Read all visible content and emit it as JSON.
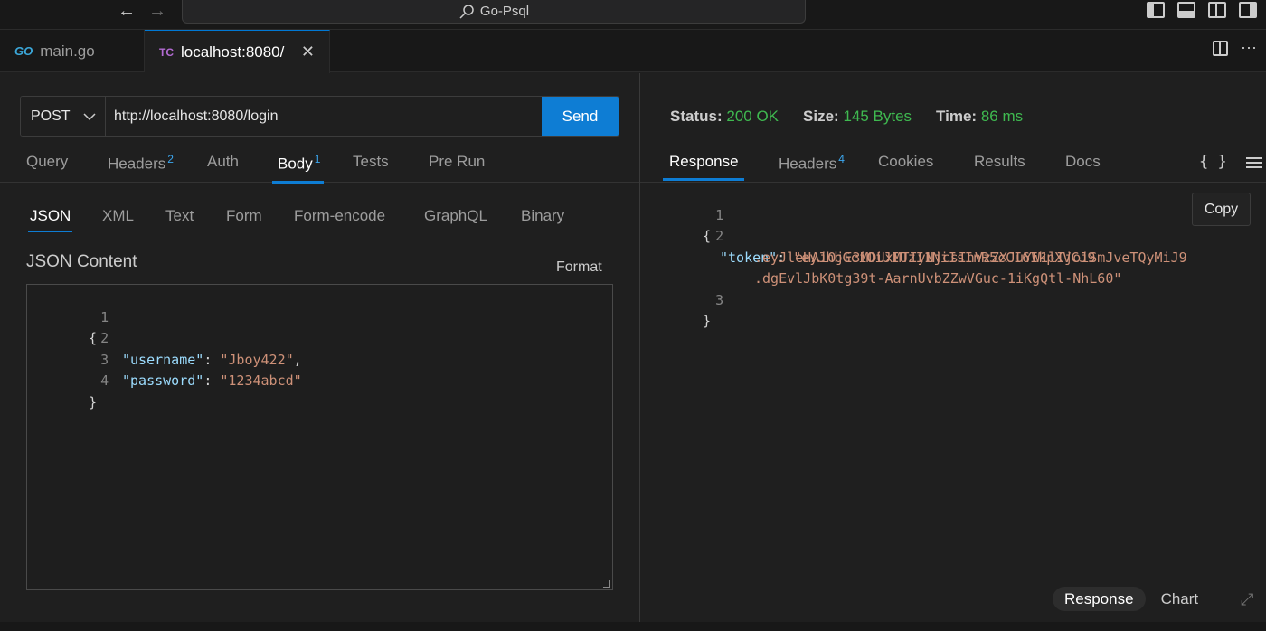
{
  "window": {
    "title": "Go-Psql",
    "back_icon": "←",
    "forward_icon": "→"
  },
  "tabs": [
    {
      "icon": "GO",
      "label": "main.go"
    },
    {
      "icon": "TC",
      "label": "localhost:8080/",
      "close": "✕"
    }
  ],
  "tab_actions": {
    "more": "···"
  },
  "request": {
    "method": "POST",
    "method_caret": "⌵",
    "url": "http://localhost:8080/login",
    "send_label": "Send",
    "tabs": [
      {
        "label": "Query"
      },
      {
        "label": "Headers",
        "badge": "2"
      },
      {
        "label": "Auth"
      },
      {
        "label": "Body",
        "badge": "1"
      },
      {
        "label": "Tests"
      },
      {
        "label": "Pre Run"
      }
    ],
    "body_tabs": [
      "JSON",
      "XML",
      "Text",
      "Form",
      "Form-encode",
      "GraphQL",
      "Binary"
    ],
    "json_title": "JSON Content",
    "format_label": "Format",
    "code": {
      "l1": {
        "num": "1",
        "open": "{"
      },
      "l2": {
        "num": "2",
        "key": "\"username\"",
        "sep": ": ",
        "val": "\"Jboy422\"",
        "end": ","
      },
      "l3": {
        "num": "3",
        "key": "\"password\"",
        "sep": ": ",
        "val": "\"1234abcd\""
      },
      "l4": {
        "num": "4",
        "close": "}"
      }
    }
  },
  "response": {
    "status_label": "Status:",
    "status_value": "200 OK",
    "size_label": "Size:",
    "size_value": "145 Bytes",
    "time_label": "Time:",
    "time_value": "86 ms",
    "tabs": [
      {
        "label": "Response"
      },
      {
        "label": "Headers",
        "badge": "4"
      },
      {
        "label": "Cookies"
      },
      {
        "label": "Results"
      },
      {
        "label": "Docs"
      }
    ],
    "braces_icon": "{ }",
    "copy_label": "Copy",
    "code": {
      "l1": {
        "num": "1",
        "open": "{"
      },
      "l2": {
        "num": "2",
        "key": "\"token\"",
        "sep": ": ",
        "val1": "\"eyJhbGciOiJIUzI1NiIsInR5cCI6IkpXVCJ9",
        "val2": ".eyJleHAiOjE3MDUxMTIyNjcsInVzZXJuYW1lIjoiSmJveTQyMiJ9",
        "val3": ".dgEvlJbK0tg39t-AarnUvbZZwVGuc-1iKgQtl-NhL60\""
      },
      "l3": {
        "num": "3",
        "close": "}"
      }
    },
    "view_toggle": [
      "Response",
      "Chart"
    ],
    "expand_icon": "⤢"
  },
  "colors": {
    "accent": "#0e7dd4",
    "status_green": "#3fb950",
    "json_key": "#9cdcfe",
    "json_string": "#ce9178"
  }
}
